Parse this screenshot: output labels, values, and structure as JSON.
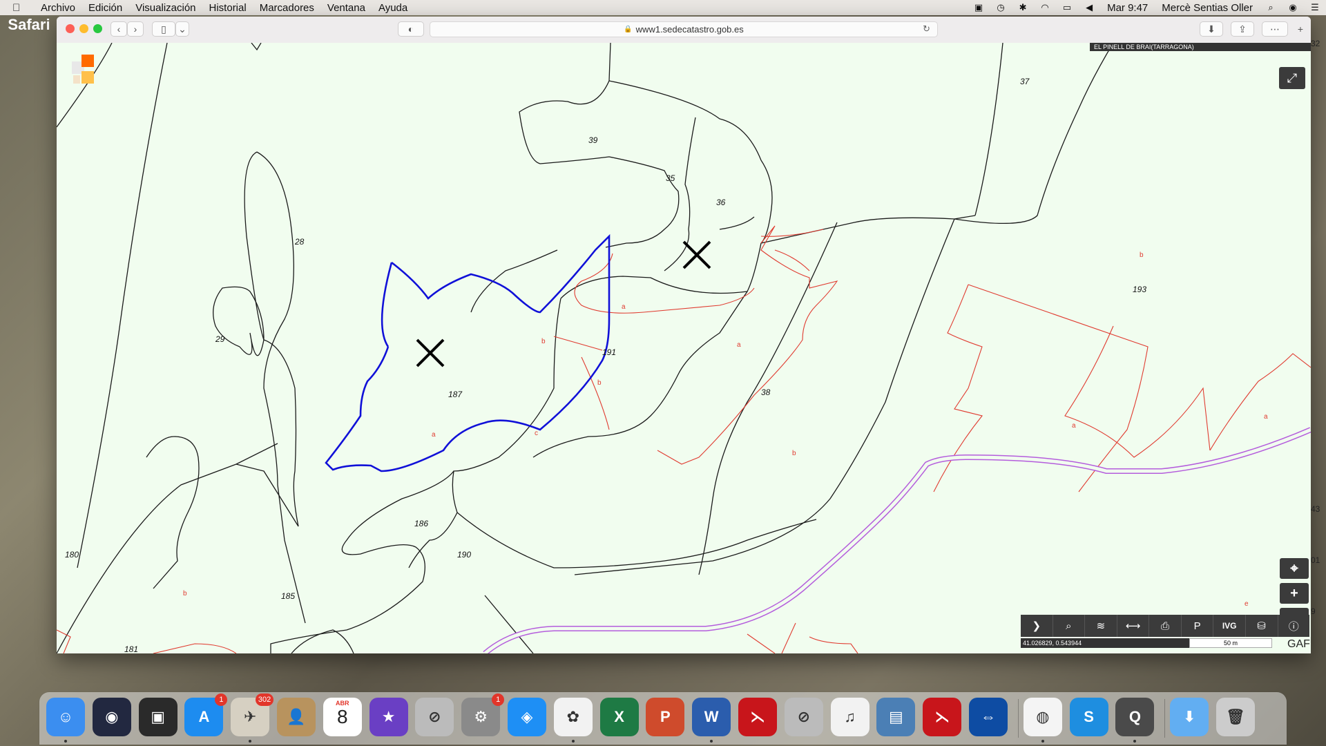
{
  "menubar": {
    "app_name": "Safari",
    "items": [
      "Archivo",
      "Edición",
      "Visualización",
      "Historial",
      "Marcadores",
      "Ventana",
      "Ayuda"
    ],
    "clock": "Mar 9:47",
    "user": "Mercè Sentias Oller"
  },
  "browser": {
    "url": "www1.sedecatastro.gob.es"
  },
  "map": {
    "municipality": "EL PINELL DE BRAI(TARRAGONA)",
    "coordinates": "41.026829, 0.543944",
    "scale": "50 m",
    "parcel_labels": [
      "37",
      "39",
      "35",
      "36",
      "28",
      "29",
      "191",
      "187",
      "38",
      "193",
      "186",
      "190",
      "180",
      "185",
      "181"
    ],
    "subparcel_labels": [
      "a",
      "b",
      "b",
      "a",
      "c",
      "a",
      "b",
      "b",
      "a",
      "a",
      "b",
      "e"
    ],
    "edge_labels": [
      "32",
      "43",
      "01",
      "9"
    ],
    "corner_text": "GAF",
    "colors": {
      "background": "#f1fdef",
      "parcel_line": "#1a1a1a",
      "subparcel_line": "#e03a2f",
      "selected_parcel": "#1010d8",
      "road": "#b45cdc"
    }
  },
  "toolstrip": {
    "icons": [
      "chevron-right-icon",
      "search-icon",
      "layers-icon",
      "measure-icon",
      "print-icon",
      "parcel-icon",
      "ivg",
      "overlay-icon",
      "info-icon"
    ],
    "ivg_label": "IVG"
  },
  "dock": {
    "apps": [
      {
        "name": "finder",
        "color": "#3b8ef0",
        "glyph": "☺"
      },
      {
        "name": "siri",
        "color": "#222840",
        "glyph": "◉"
      },
      {
        "name": "photo-booth",
        "color": "#2a2a2a",
        "glyph": "▣"
      },
      {
        "name": "app-store",
        "color": "#1d8cf0",
        "glyph": "A",
        "badge": "1"
      },
      {
        "name": "mail",
        "color": "#d6d0c2",
        "glyph": "✈",
        "badge": "302"
      },
      {
        "name": "contacts",
        "color": "#b8935e",
        "glyph": "👤"
      },
      {
        "name": "calendar",
        "color": "#ffffff",
        "glyph": "8",
        "subtext": "ABR"
      },
      {
        "name": "imovie",
        "color": "#6a3fc4",
        "glyph": "★"
      },
      {
        "name": "app-blocked",
        "color": "#bbbbbb",
        "glyph": "⊘"
      },
      {
        "name": "system-preferences",
        "color": "#8a8a8a",
        "glyph": "⚙",
        "badge": "1"
      },
      {
        "name": "safari",
        "color": "#1e8ff5",
        "glyph": "◈"
      },
      {
        "name": "photos",
        "color": "#f2f2f2",
        "glyph": "✿"
      },
      {
        "name": "excel",
        "color": "#1e7a44",
        "glyph": "X"
      },
      {
        "name": "powerpoint",
        "color": "#cf4b2c",
        "glyph": "P"
      },
      {
        "name": "word",
        "color": "#2b5dad",
        "glyph": "W"
      },
      {
        "name": "acrobat",
        "color": "#c8151b",
        "glyph": "⋋"
      },
      {
        "name": "app-blocked-2",
        "color": "#bbbbbb",
        "glyph": "⊘"
      },
      {
        "name": "itunes",
        "color": "#f2f2f2",
        "glyph": "♫"
      },
      {
        "name": "preview",
        "color": "#4b7fb5",
        "glyph": "▤"
      },
      {
        "name": "acrobat-reader",
        "color": "#c8151b",
        "glyph": "⋋"
      },
      {
        "name": "teamviewer",
        "color": "#0e4ca3",
        "glyph": "⇔"
      },
      {
        "name": "chrome",
        "color": "#f4f4f4",
        "glyph": "◍"
      },
      {
        "name": "skype",
        "color": "#1e8ee0",
        "glyph": "S"
      },
      {
        "name": "quicktime",
        "color": "#4a4a4a",
        "glyph": "Q"
      },
      {
        "name": "downloads-folder",
        "color": "#62aef2",
        "glyph": "⬇"
      },
      {
        "name": "trash",
        "color": "#cccccc",
        "glyph": "🗑"
      }
    ]
  }
}
